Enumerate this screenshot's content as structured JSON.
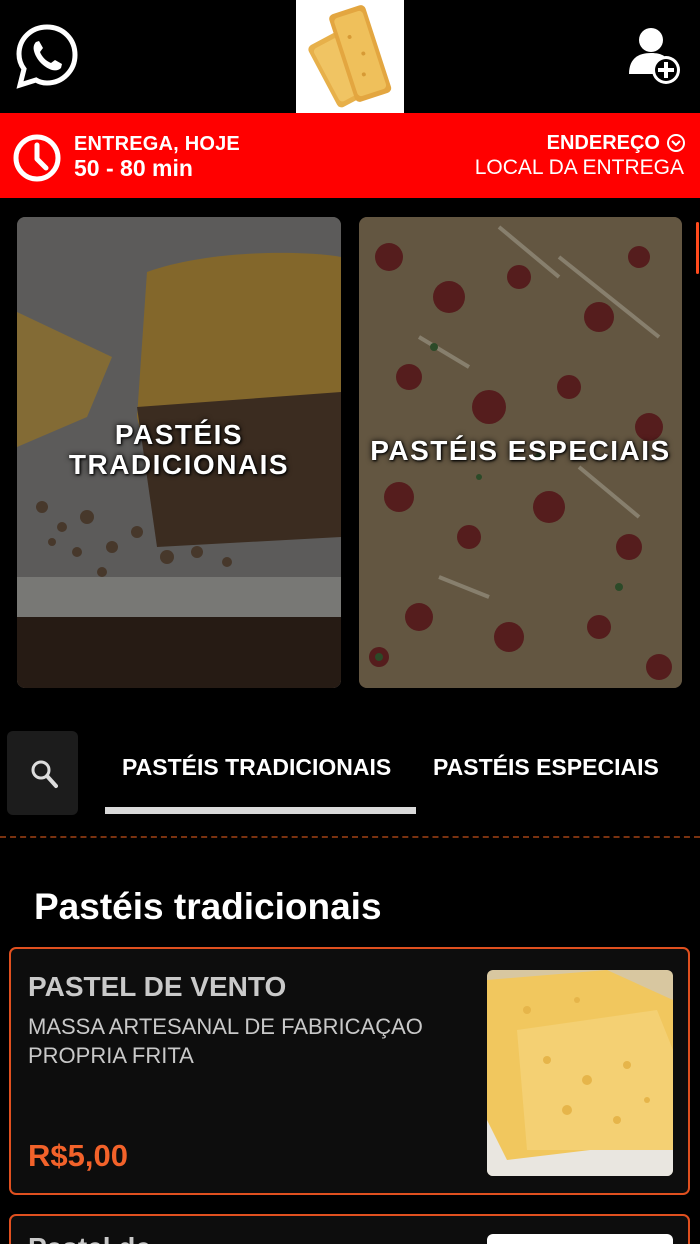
{
  "header": {
    "whatsapp_icon": "whatsapp-icon",
    "logo": "pastel-logo",
    "user_add_icon": "user-add-icon"
  },
  "delivery": {
    "title": "ENTREGA, HOJE",
    "time": "50 - 80 min",
    "address_title": "ENDEREÇO",
    "address_sub": "LOCAL DA ENTREGA",
    "color": "#ff0000"
  },
  "categories": [
    {
      "label_line1": "PASTÉIS",
      "label_line2": "TRADICIONAIS"
    },
    {
      "label_line1": "PASTÉIS ESPECIAIS"
    }
  ],
  "tabs": [
    {
      "label": "PASTÉIS TRADICIONAIS",
      "active": true
    },
    {
      "label": "PASTÉIS ESPECIAIS",
      "active": false
    }
  ],
  "section": {
    "title": "Pastéis tradicionais"
  },
  "products": [
    {
      "name": "PASTEL DE VENTO",
      "description": "MASSA ARTESANAL DE FABRICAÇAO PROPRIA FRITA",
      "price": "R$5,00"
    },
    {
      "name": "Pastel de"
    }
  ],
  "colors": {
    "accent": "#f2622a",
    "border": "#e0501f",
    "background": "#000000"
  }
}
